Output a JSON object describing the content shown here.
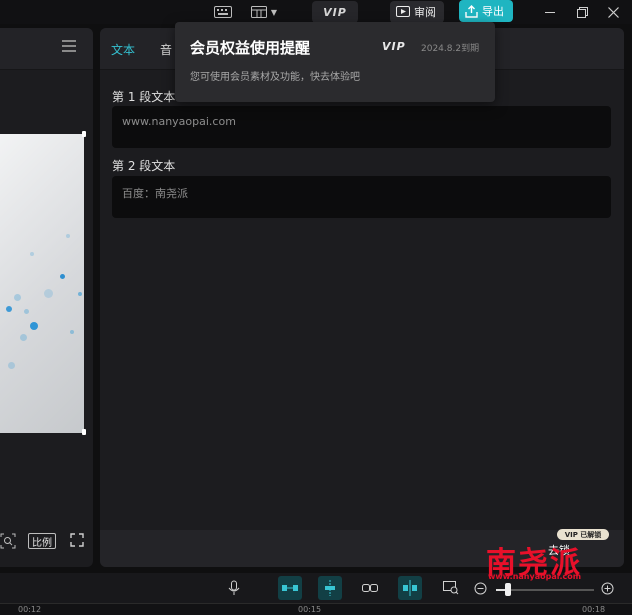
{
  "topbar": {
    "keyboard_icon": "keyboard-icon",
    "layout_icon": "layout-icon",
    "vip_label": "VIP",
    "review_label": "审阅",
    "export_label": "导出"
  },
  "text_panel": {
    "tabs": [
      {
        "label": "文本",
        "active": true
      },
      {
        "label": "音",
        "active": false
      }
    ],
    "segments": [
      {
        "label": "第 1 段文本",
        "value": "www.nanyaopai.com"
      },
      {
        "label": "第 2 段文本",
        "value": "百度：南尧派"
      }
    ]
  },
  "vip_popup": {
    "title": "会员权益使用提醒",
    "vip_mark": "VIP",
    "expire": "2024.8.2到期",
    "description": "您可使用会员素材及功能，快去体验吧"
  },
  "player": {
    "ratio_label": "比例"
  },
  "vip_unlock": {
    "badge": "VIP 已解锁",
    "label": "去锁"
  },
  "timeline": {
    "zoom_level": 0.12,
    "ruler": [
      "00:12",
      "00:15",
      "00:18"
    ]
  },
  "watermark": {
    "text": "南尧派",
    "url": "www.nanyaopai.com"
  },
  "colors": {
    "accent": "#34c1d1",
    "export_bg": "#1fb5c1",
    "watermark": "#e8102a"
  }
}
